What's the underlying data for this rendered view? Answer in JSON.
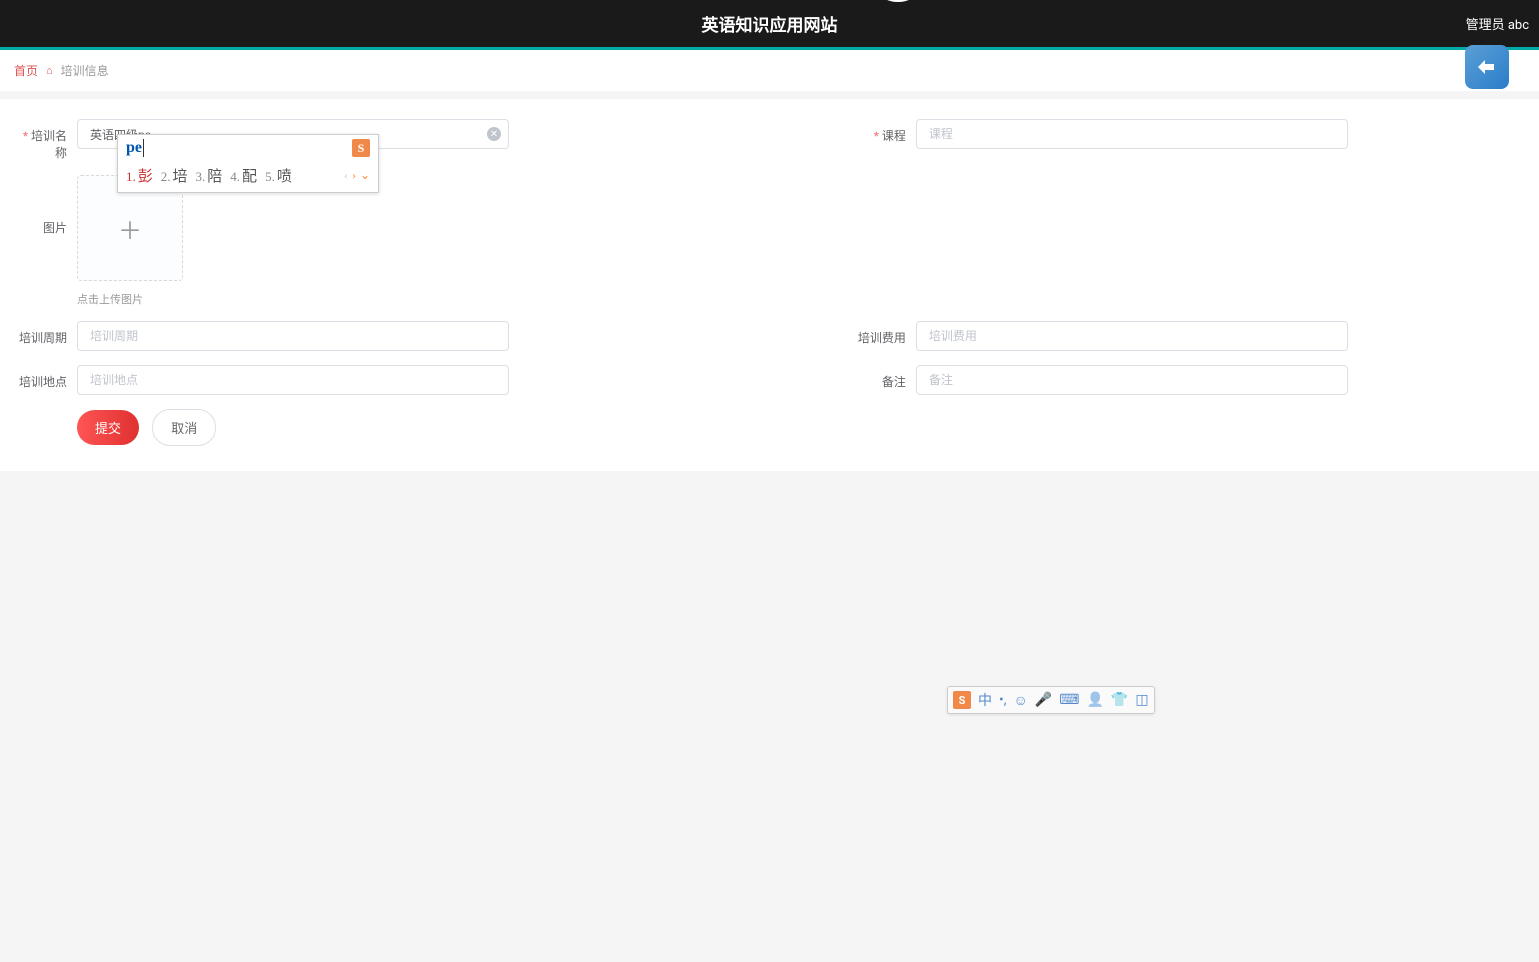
{
  "header": {
    "title": "英语知识应用网站",
    "admin": "管理员 abc"
  },
  "breadcrumb": {
    "home": "首页",
    "current": "培训信息"
  },
  "form": {
    "trainingName": {
      "label": "培训名称",
      "value": "英语四级pe"
    },
    "course": {
      "label": "课程",
      "placeholder": "课程"
    },
    "image": {
      "label": "图片",
      "hint": "点击上传图片"
    },
    "cycle": {
      "label": "培训周期",
      "placeholder": "培训周期"
    },
    "fee": {
      "label": "培训费用",
      "placeholder": "培训费用"
    },
    "location": {
      "label": "培训地点",
      "placeholder": "培训地点"
    },
    "remark": {
      "label": "备注",
      "placeholder": "备注"
    }
  },
  "buttons": {
    "submit": "提交",
    "cancel": "取消"
  },
  "ime": {
    "typed": "pe",
    "logo": "S",
    "candidates": [
      {
        "num": "1.",
        "char": "彭"
      },
      {
        "num": "2.",
        "char": "培"
      },
      {
        "num": "3.",
        "char": "陪"
      },
      {
        "num": "4.",
        "char": "配"
      },
      {
        "num": "5.",
        "char": "喷"
      }
    ],
    "toolbar": {
      "logo": "S",
      "lang": "中"
    }
  }
}
